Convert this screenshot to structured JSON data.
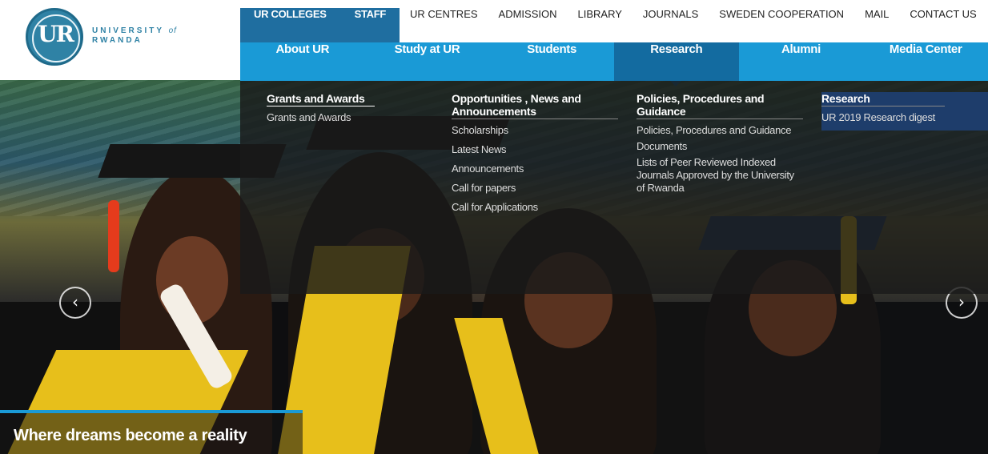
{
  "logo": {
    "letters": "UR",
    "line1": "UNIVERSITY",
    "of": "of",
    "line2": "RWANDA"
  },
  "topbar": [
    "UR COLLEGES",
    "STAFF",
    "UR CENTRES",
    "ADMISSION",
    "LIBRARY",
    "JOURNALS",
    "SWEDEN COOPERATION",
    "MAIL",
    "CONTACT US"
  ],
  "mainnav": [
    "About UR",
    "Study at UR",
    "Students",
    "Research",
    "Alumni",
    "Media Center"
  ],
  "mega": {
    "col1": {
      "heading": "Grants and Awards",
      "items": [
        "Grants and Awards"
      ]
    },
    "col2": {
      "heading": "Opportunities , News and Announcements",
      "items": [
        "Scholarships",
        "Latest News",
        "Announcements",
        "Call for papers",
        "Call for Applications"
      ]
    },
    "col3": {
      "heading": "Policies, Procedures and Guidance",
      "items": [
        "Policies, Procedures and Guidance",
        "Documents",
        "Lists of Peer Reviewed Indexed Journals Approved by the University of Rwanda"
      ]
    },
    "col4": {
      "heading": "Research",
      "items": [
        "UR 2019 Research digest"
      ]
    }
  },
  "hero": {
    "caption": "Where dreams become a reality",
    "prev_glyph": "‹",
    "next_glyph": "›"
  },
  "colors": {
    "primary": "#1a9ad6",
    "dark_blue": "#1f6ea0",
    "active": "#136ba0"
  }
}
